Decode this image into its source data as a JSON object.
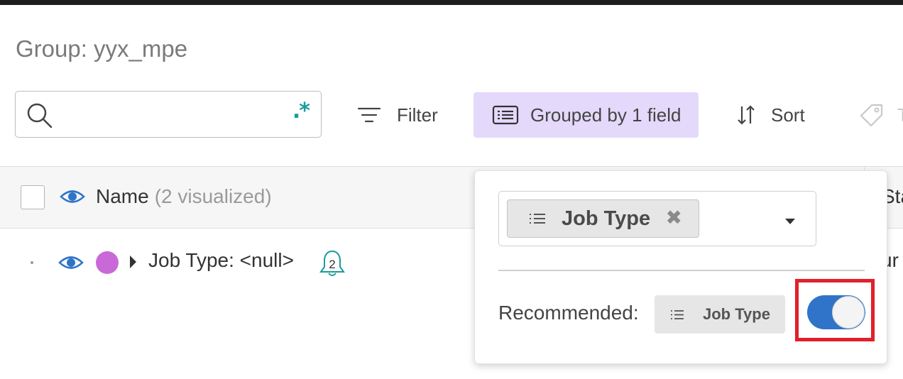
{
  "header": {
    "group_title": "Group: yyx_mpe"
  },
  "search": {
    "value": "",
    "placeholder": "",
    "regex_toggle": ".*"
  },
  "toolbar": {
    "filter_label": "Filter",
    "grouped_label": "Grouped by 1 field",
    "sort_label": "Sort",
    "tag_label": "T"
  },
  "table": {
    "name_header": "Name",
    "visualized_note": "(2 visualized)",
    "next_column_partial": "Sta",
    "rows": [
      {
        "label": "Job Type: <null>",
        "bell_count": "2",
        "right_partial": "ur"
      }
    ]
  },
  "group_popover": {
    "selected_field": "Job Type",
    "remove_glyph": "✖",
    "recommended_label": "Recommended:",
    "recommended_field": "Job Type",
    "toggle_on": true
  },
  "colors": {
    "accent_purple_bg": "#e4d9fb",
    "toggle_blue": "#2f74c8",
    "eye_blue": "#2f74c8",
    "row_dot": "#c969d8",
    "bell_teal": "#1a9d9a",
    "highlight_red": "#e0202a"
  },
  "icons": [
    "search-icon",
    "regex-icon",
    "filter-icon",
    "grouped-list-icon",
    "sort-icon",
    "tag-icon",
    "eye-icon",
    "caret-right-icon",
    "bell-icon",
    "list-icon",
    "remove-icon",
    "chevron-down-icon"
  ]
}
